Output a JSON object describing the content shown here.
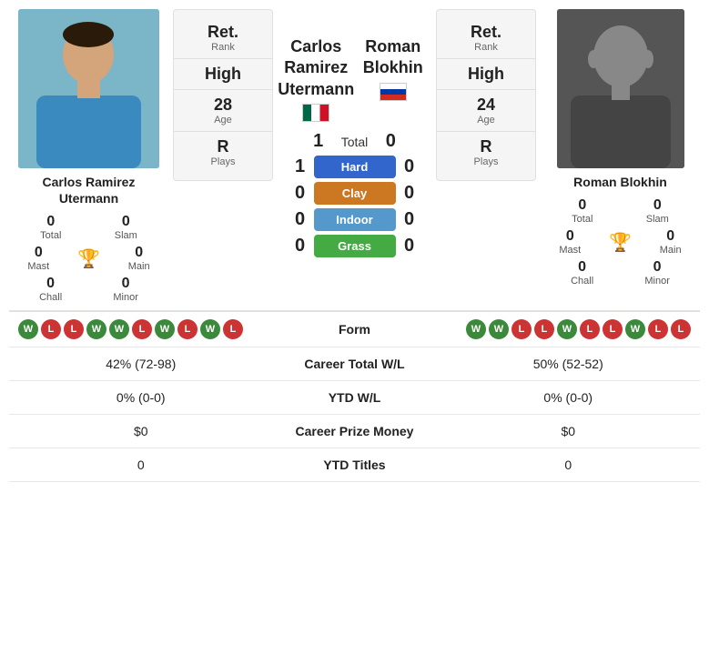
{
  "player1": {
    "name": "Carlos Ramirez Utermann",
    "name_line1": "Carlos Ramirez",
    "name_line2": "Utermann",
    "flag": "mexico",
    "stats": {
      "total": "0",
      "slam": "0",
      "mast": "0",
      "main": "0",
      "chall": "0",
      "minor": "0"
    },
    "rank_label": "Ret.",
    "rank_sublabel": "Rank",
    "high_label": "High",
    "age_value": "28",
    "age_label": "Age",
    "plays_value": "R",
    "plays_label": "Plays"
  },
  "player2": {
    "name": "Roman Blokhin",
    "flag": "russia",
    "stats": {
      "total": "0",
      "slam": "0",
      "mast": "0",
      "main": "0",
      "chall": "0",
      "minor": "0"
    },
    "rank_label": "Ret.",
    "rank_sublabel": "Rank",
    "high_label": "High",
    "age_value": "24",
    "age_label": "Age",
    "plays_value": "R",
    "plays_label": "Plays"
  },
  "scores": {
    "total_label": "Total",
    "total_left": "1",
    "total_right": "0",
    "hard_left": "1",
    "hard_right": "0",
    "hard_label": "Hard",
    "clay_left": "0",
    "clay_right": "0",
    "clay_label": "Clay",
    "indoor_left": "0",
    "indoor_right": "0",
    "indoor_label": "Indoor",
    "grass_left": "0",
    "grass_right": "0",
    "grass_label": "Grass"
  },
  "form": {
    "label": "Form",
    "player1_badges": [
      "W",
      "L",
      "L",
      "W",
      "W",
      "L",
      "W",
      "L",
      "W",
      "L"
    ],
    "player2_badges": [
      "W",
      "W",
      "L",
      "L",
      "W",
      "L",
      "L",
      "W",
      "L",
      "L"
    ]
  },
  "career": {
    "total_wl_label": "Career Total W/L",
    "player1_total_wl": "42% (72-98)",
    "player2_total_wl": "50% (52-52)",
    "ytd_wl_label": "YTD W/L",
    "player1_ytd_wl": "0% (0-0)",
    "player2_ytd_wl": "0% (0-0)",
    "prize_label": "Career Prize Money",
    "player1_prize": "$0",
    "player2_prize": "$0",
    "titles_label": "YTD Titles",
    "player1_titles": "0",
    "player2_titles": "0"
  }
}
